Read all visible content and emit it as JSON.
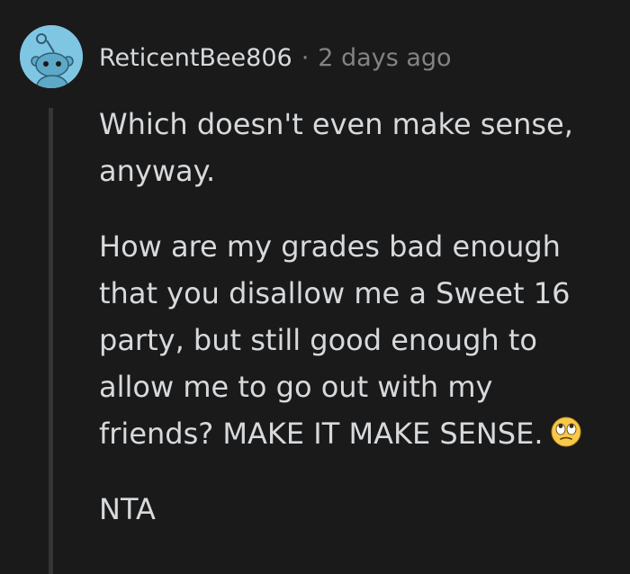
{
  "comment": {
    "author": "ReticentBee806",
    "separator": "·",
    "timestamp": "2 days ago",
    "avatar_icon": "reddit-snoo-avatar-icon",
    "paragraphs": [
      "Which doesn't even make sense, anyway.",
      "How are my grades bad enough that you disallow me a Sweet 16 party, but still good enough to allow me to go out with my friends? MAKE IT MAKE SENSE.",
      "NTA"
    ],
    "emoji_icon": "eye-roll-emoji-icon"
  },
  "colors": {
    "background": "#1a1a1b",
    "text": "#d7dadc",
    "meta": "#818384",
    "avatar_bg": "#7fc6e3",
    "thread_line": "#343536"
  }
}
